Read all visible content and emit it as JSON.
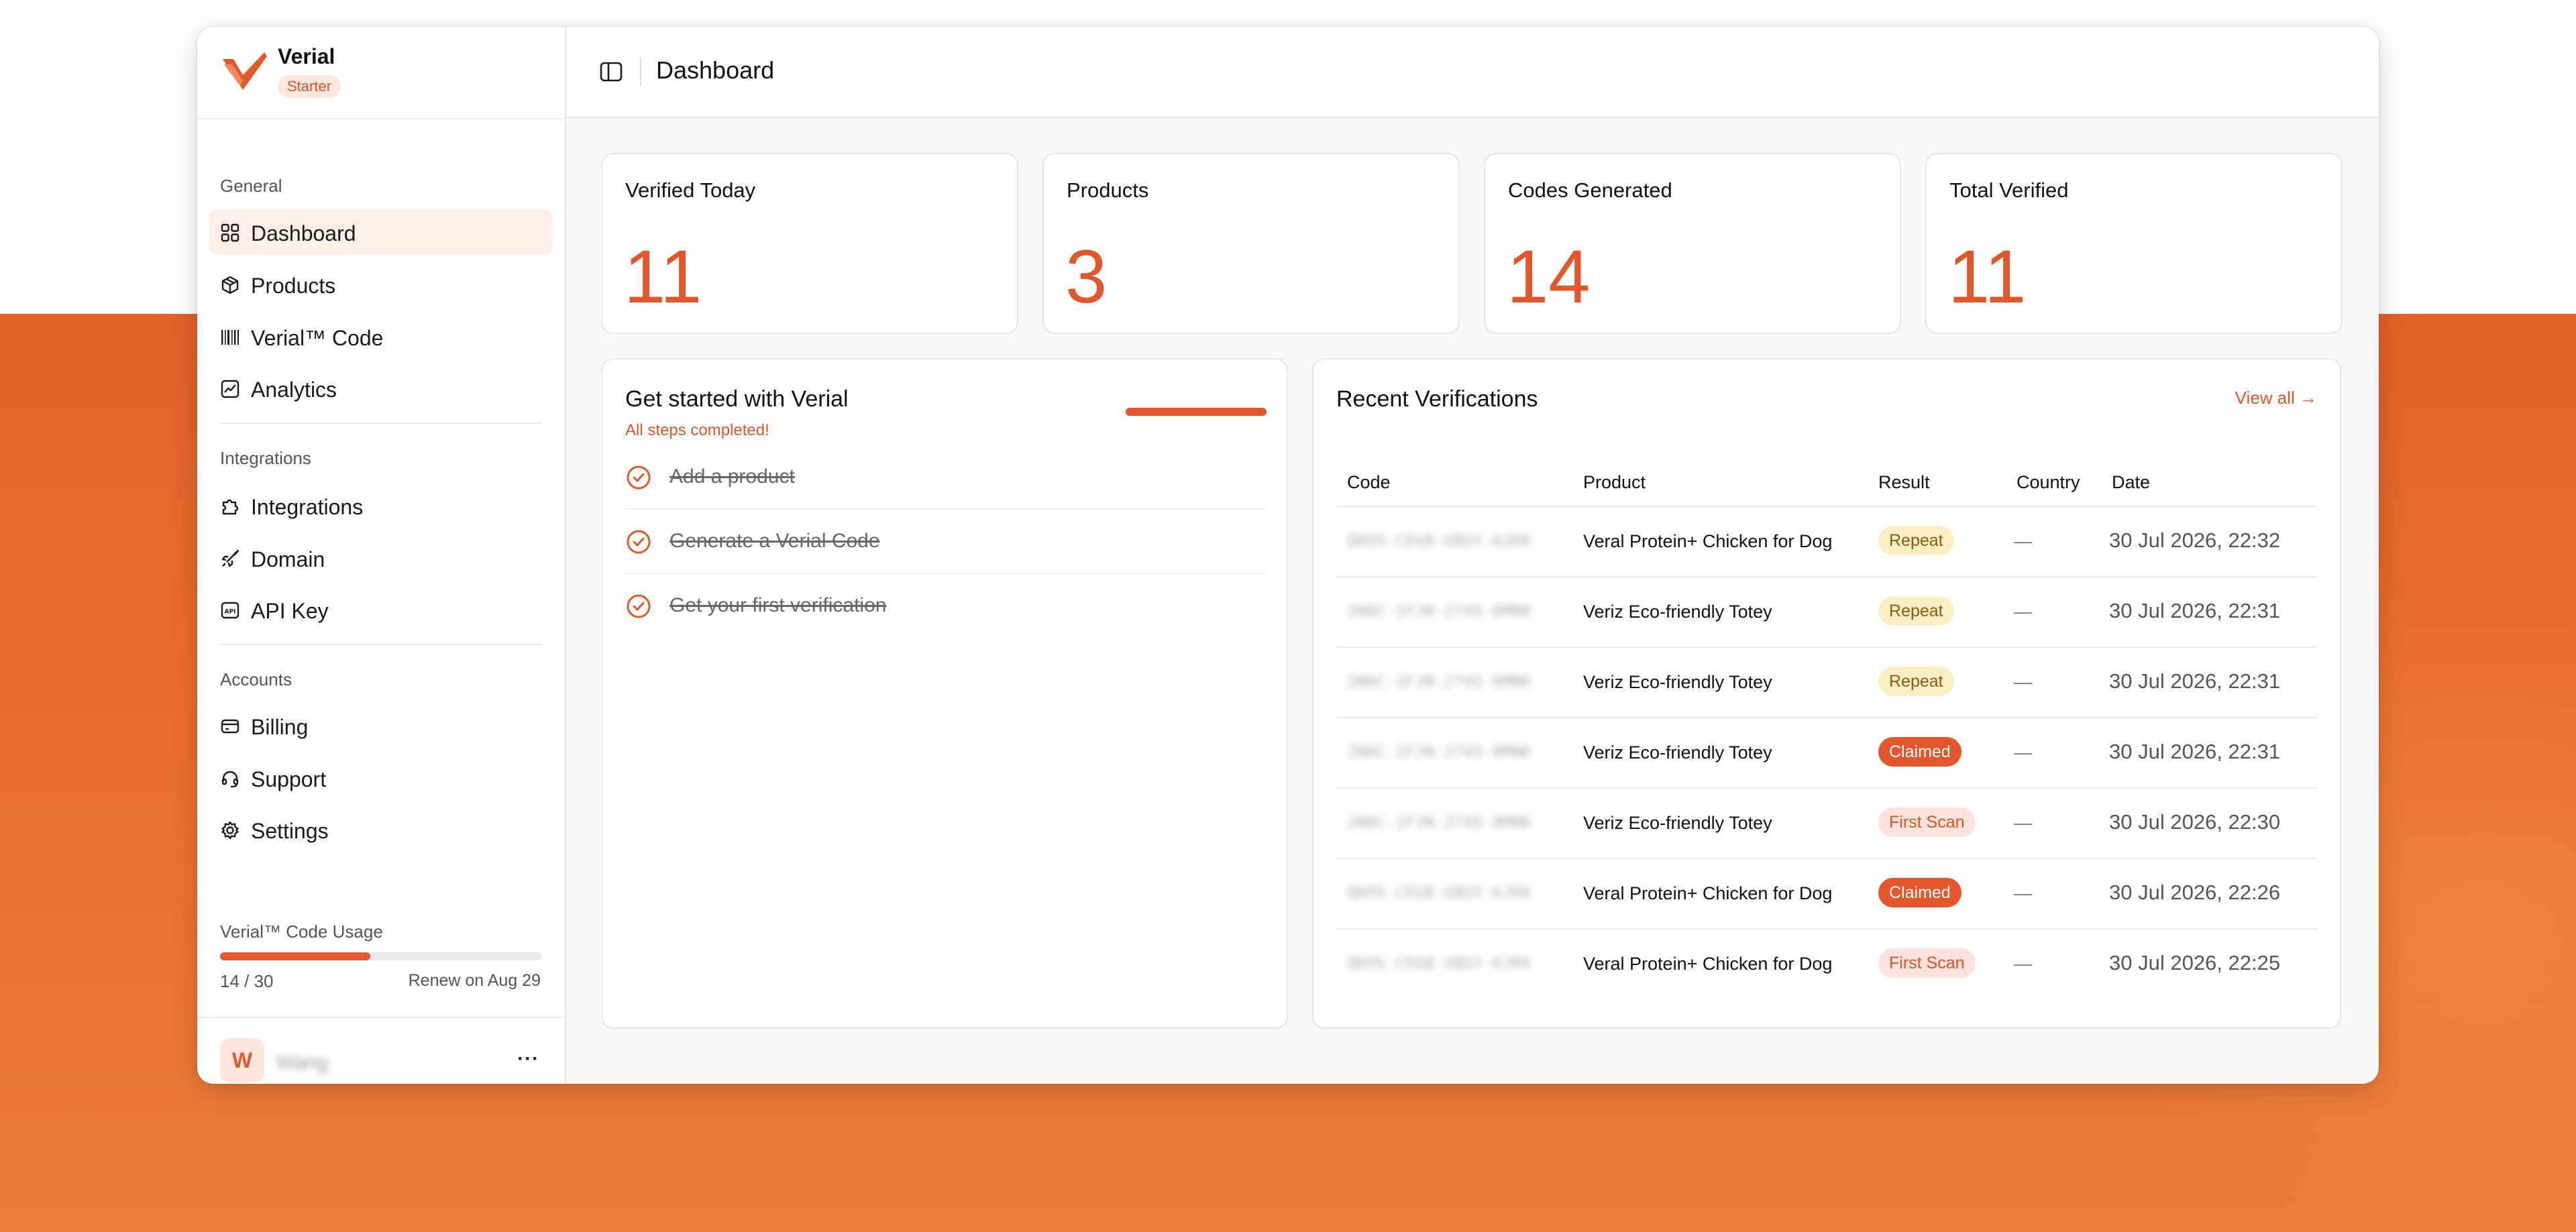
{
  "app": {
    "name": "Verial",
    "plan": "Starter"
  },
  "colors": {
    "accent": "#e2562a",
    "accent_soft": "#fdeee8",
    "repeat_badge": "#fbefc4",
    "claimed_badge": "#e4562b",
    "first_scan_badge": "#fde3db"
  },
  "sidebar": {
    "sections": [
      {
        "label": "General"
      },
      {
        "label": "Integrations"
      },
      {
        "label": "Accounts"
      }
    ],
    "items": [
      {
        "label": "Dashboard",
        "icon": "dashboard-grid-icon",
        "active": true
      },
      {
        "label": "Products",
        "icon": "box-icon"
      },
      {
        "label": "Verial™ Code",
        "icon": "barcode-icon"
      },
      {
        "label": "Analytics",
        "icon": "chart-icon"
      },
      {
        "label": "Integrations",
        "icon": "puzzle-icon"
      },
      {
        "label": "Domain",
        "icon": "rocket-icon"
      },
      {
        "label": "API Key",
        "icon": "api-icon"
      },
      {
        "label": "Billing",
        "icon": "credit-card-icon"
      },
      {
        "label": "Support",
        "icon": "headset-icon"
      },
      {
        "label": "Settings",
        "icon": "gear-icon"
      }
    ],
    "usage": {
      "label": "Verial™ Code Usage",
      "count": "14 / 30",
      "used": 14,
      "total": 30,
      "renew": "Renew on Aug 29"
    },
    "user": {
      "initial": "W",
      "name": "Wang",
      "menu": "···"
    }
  },
  "topbar": {
    "title": "Dashboard"
  },
  "stats": [
    {
      "label": "Verified Today",
      "value": "11"
    },
    {
      "label": "Products",
      "value": "3"
    },
    {
      "label": "Codes Generated",
      "value": "14"
    },
    {
      "label": "Total Verified",
      "value": "11"
    }
  ],
  "getting_started": {
    "title": "Get started with Verial",
    "subtitle": "All steps completed!",
    "progress": 1.0,
    "steps": [
      {
        "label": "Add a product",
        "done": true
      },
      {
        "label": "Generate a Verial Code",
        "done": true
      },
      {
        "label": "Get your first verification",
        "done": true
      }
    ]
  },
  "recent": {
    "title": "Recent Verifications",
    "view_all": "View all →",
    "columns": [
      "Code",
      "Product",
      "Result",
      "Country",
      "Date"
    ],
    "rows": [
      {
        "code": "QKOS-CEG8-U8GY-6JKK",
        "product": "Veral Protein+ Chicken for Dog",
        "result": "Repeat",
        "type": "repeat",
        "country": "—",
        "date": "30 Jul 2026, 22:32"
      },
      {
        "code": "2N6C-1FJN-2745-0MNK",
        "product": "Veriz Eco-friendly Totey",
        "result": "Repeat",
        "type": "repeat",
        "country": "—",
        "date": "30 Jul 2026, 22:31"
      },
      {
        "code": "2N6C-1FJN-2745-0MNK",
        "product": "Veriz Eco-friendly Totey",
        "result": "Repeat",
        "type": "repeat",
        "country": "—",
        "date": "30 Jul 2026, 22:31"
      },
      {
        "code": "2N6C-1FJN-2745-0MNK",
        "product": "Veriz Eco-friendly Totey",
        "result": "Claimed",
        "type": "claimed",
        "country": "—",
        "date": "30 Jul 2026, 22:31"
      },
      {
        "code": "2N6C-1FJN-2745-0MNK",
        "product": "Veriz Eco-friendly Totey",
        "result": "First Scan",
        "type": "first",
        "country": "—",
        "date": "30 Jul 2026, 22:30"
      },
      {
        "code": "QKOS-CEG8-U8GY-6JKK",
        "product": "Veral Protein+ Chicken for Dog",
        "result": "Claimed",
        "type": "claimed",
        "country": "—",
        "date": "30 Jul 2026, 22:26"
      },
      {
        "code": "QKOS-CEG8-U8GY-6JKK",
        "product": "Veral Protein+ Chicken for Dog",
        "result": "First Scan",
        "type": "first",
        "country": "—",
        "date": "30 Jul 2026, 22:25"
      }
    ]
  }
}
